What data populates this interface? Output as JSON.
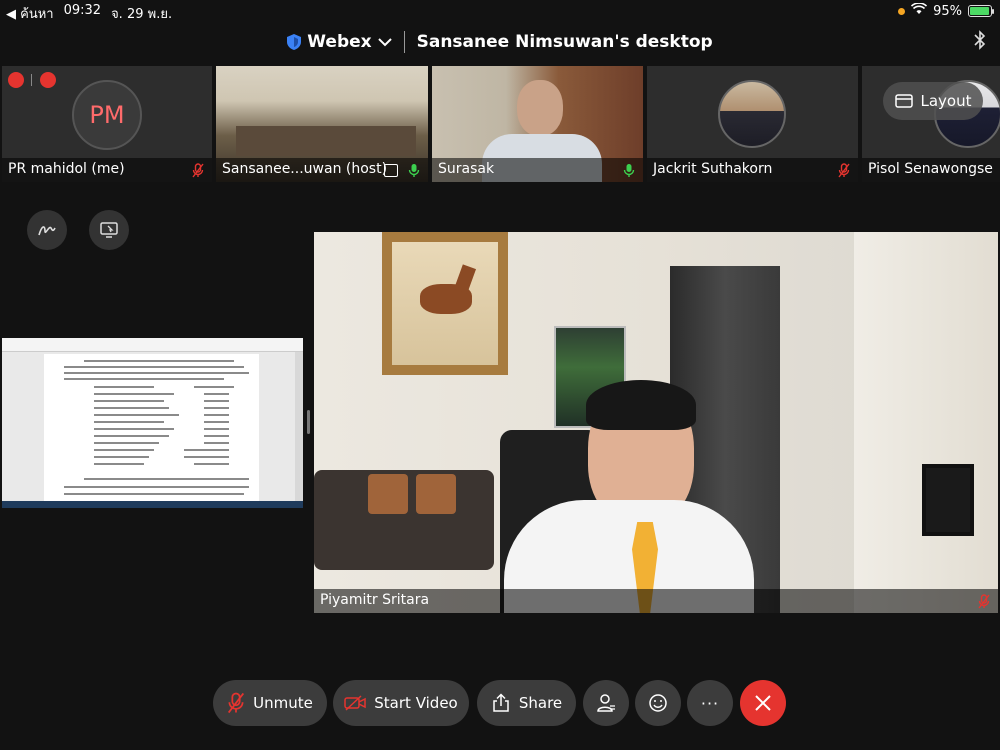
{
  "status_bar": {
    "back_label": "◀ ค้นหา",
    "time": "09:32",
    "date": "จ. 29 พ.ย.",
    "battery": "95%",
    "battery_level": 0.95
  },
  "header": {
    "app_name": "Webex",
    "window_title": "Sansanee Nimsuwan's desktop"
  },
  "layout_button": {
    "label": "Layout"
  },
  "participants": [
    {
      "name": "PR mahidol (me)",
      "initials": "PM",
      "mic": "muted"
    },
    {
      "name": "Sansanee...uwan (host)",
      "mic": "active"
    },
    {
      "name": "Surasak",
      "mic": "active"
    },
    {
      "name": "Jackrit Suthakorn",
      "mic": "muted"
    },
    {
      "name": "Pisol Senawongse",
      "mic": "none"
    }
  ],
  "main_video": {
    "name": "Piyamitr Sritara"
  },
  "toolbar": {
    "unmute_label": "Unmute",
    "start_video_label": "Start Video",
    "share_label": "Share",
    "more_label": "···"
  },
  "colors": {
    "mute_red": "#e5342f",
    "mic_green": "#3ccf4e",
    "end_call_red": "#e5342f",
    "shield_blue": "#3b82f6"
  }
}
